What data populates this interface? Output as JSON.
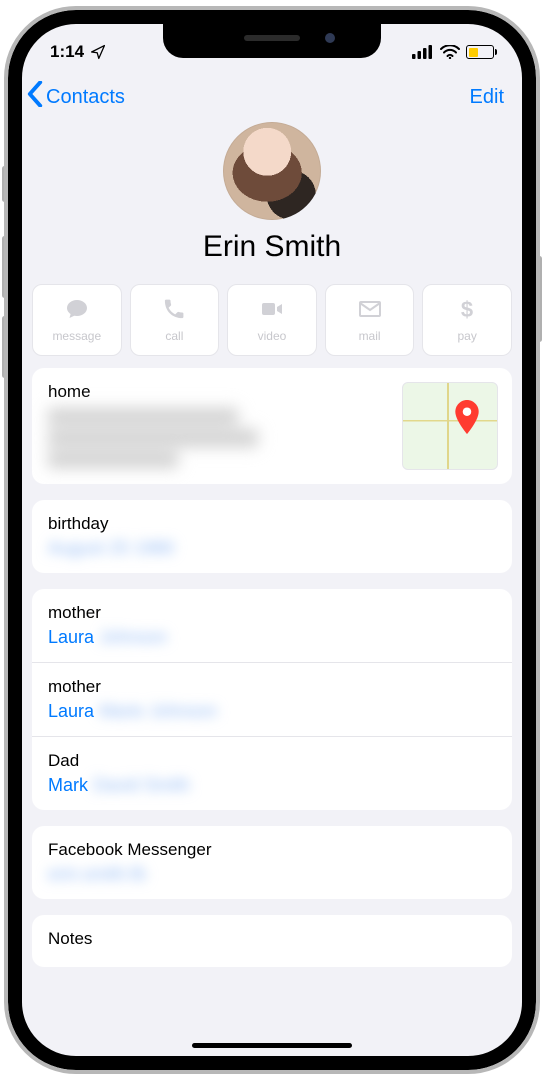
{
  "status": {
    "time": "1:14",
    "location_arrow": true
  },
  "nav": {
    "back_label": "Contacts",
    "edit_label": "Edit"
  },
  "contact": {
    "name": "Erin Smith"
  },
  "actions": [
    {
      "icon": "message",
      "label": "message"
    },
    {
      "icon": "call",
      "label": "call"
    },
    {
      "icon": "video",
      "label": "video"
    },
    {
      "icon": "mail",
      "label": "mail"
    },
    {
      "icon": "pay",
      "label": "pay"
    }
  ],
  "address": {
    "label": "home",
    "value_blurred": true
  },
  "birthday": {
    "label": "birthday",
    "value_blurred": true
  },
  "relations": [
    {
      "label": "mother",
      "name": "Laura",
      "rest_blurred": true
    },
    {
      "label": "mother",
      "name": "Laura",
      "rest_blurred": true
    },
    {
      "label": "Dad",
      "name": "Mark",
      "rest_blurred": true
    }
  ],
  "social": {
    "label": "Facebook Messenger",
    "value_blurred": true
  },
  "notes_label": "Notes",
  "colors": {
    "accent": "#007aff",
    "battery_fill": "#ffcc00"
  }
}
